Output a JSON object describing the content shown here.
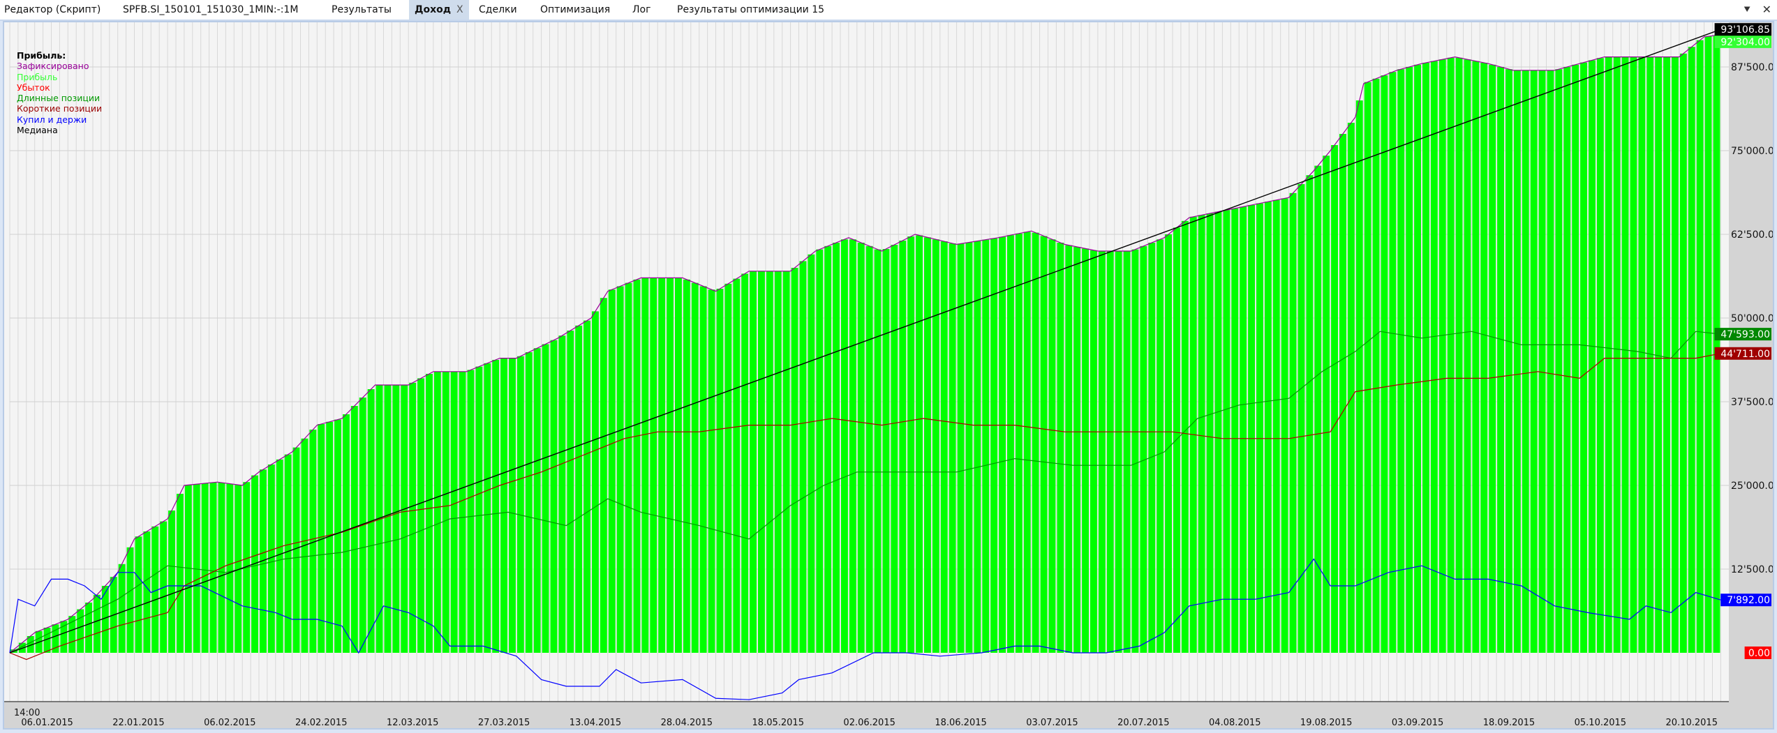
{
  "tabs": [
    {
      "label": "Редактор (Скрипт)"
    },
    {
      "label": "SPFB.SI_150101_151030_1MIN:-:1M"
    },
    {
      "label": "Результаты"
    },
    {
      "label": "Доход",
      "active": true,
      "close": "X"
    },
    {
      "label": "Сделки"
    },
    {
      "label": "Оптимизация"
    },
    {
      "label": "Лог"
    },
    {
      "label": "Результаты оптимизации 15"
    }
  ],
  "window_icons": {
    "menu": "⯆",
    "close": "✕"
  },
  "legend": {
    "title": "Прибыль:",
    "items": [
      {
        "label": "Зафиксировано",
        "color": "#990099"
      },
      {
        "label": "Прибыль",
        "color": "#33ff33"
      },
      {
        "label": "Убыток",
        "color": "#ff0000"
      },
      {
        "label": "Длинные позиции",
        "color": "#009900"
      },
      {
        "label": "Короткие позиции",
        "color": "#990000"
      },
      {
        "label": "Купил и держи",
        "color": "#0000ff"
      },
      {
        "label": "Медиана",
        "color": "#000000"
      }
    ]
  },
  "chart_data": {
    "type": "bar",
    "x_unit": "trading day index",
    "time_label": "14:00",
    "xlim": [
      0,
      206
    ],
    "ylim": [
      -7290,
      97000
    ],
    "x_ticks": [
      {
        "x": 4.5,
        "label": "06.01.2015"
      },
      {
        "x": 15.5,
        "label": "22.01.2015"
      },
      {
        "x": 26.5,
        "label": "06.02.2015"
      },
      {
        "x": 37.5,
        "label": "24.02.2015"
      },
      {
        "x": 48.5,
        "label": "12.03.2015"
      },
      {
        "x": 59.5,
        "label": "27.03.2015"
      },
      {
        "x": 70.5,
        "label": "13.04.2015"
      },
      {
        "x": 81.5,
        "label": "28.04.2015"
      },
      {
        "x": 92.5,
        "label": "18.05.2015"
      },
      {
        "x": 103.5,
        "label": "02.06.2015"
      },
      {
        "x": 114.5,
        "label": "18.06.2015"
      },
      {
        "x": 125.5,
        "label": "03.07.2015"
      },
      {
        "x": 136.5,
        "label": "20.07.2015"
      },
      {
        "x": 147.5,
        "label": "04.08.2015"
      },
      {
        "x": 158.5,
        "label": "19.08.2015"
      },
      {
        "x": 169.5,
        "label": "03.09.2015"
      },
      {
        "x": 180.5,
        "label": "18.09.2015"
      },
      {
        "x": 191.5,
        "label": "05.10.2015"
      },
      {
        "x": 202.5,
        "label": "20.10.2015"
      }
    ],
    "y_ticks": [
      {
        "y": 87500,
        "label": "87'500.00"
      },
      {
        "y": 75000,
        "label": "75'000.00"
      },
      {
        "y": 62500,
        "label": "62'500.00"
      },
      {
        "y": 50000,
        "label": "50'000.00"
      },
      {
        "y": 37500,
        "label": "37'500.00"
      },
      {
        "y": 25000,
        "label": "25'000.00"
      },
      {
        "y": 12500,
        "label": "12'500.00"
      }
    ],
    "value_labels": [
      {
        "y": 92304,
        "label": "92'304.00",
        "bg": "#33ff33",
        "fg": "#ffffff"
      },
      {
        "y": 93106.85,
        "label": "93'106.85",
        "bg": "#000000",
        "fg": "#ffffff"
      },
      {
        "y": 47593,
        "label": "47'593.00",
        "bg": "#008800",
        "fg": "#ffffff"
      },
      {
        "y": 44711,
        "label": "44'711.00",
        "bg": "#a00000",
        "fg": "#ffffff"
      },
      {
        "y": 7892,
        "label": "7'892.00",
        "bg": "#0000ff",
        "fg": "#ffffff"
      },
      {
        "y": 0,
        "label": "0.00",
        "bg": "#ff0000",
        "fg": "#ffffff"
      }
    ],
    "series": [
      {
        "name": "Прибыль",
        "kind": "bars",
        "color": "#00ff00",
        "points": [
          [
            0,
            0
          ],
          [
            3,
            3000
          ],
          [
            7,
            5000
          ],
          [
            10,
            8000
          ],
          [
            13,
            12000
          ],
          [
            15,
            17000
          ],
          [
            19,
            20000
          ],
          [
            21,
            25000
          ],
          [
            25,
            25500
          ],
          [
            28,
            25000
          ],
          [
            30,
            27000
          ],
          [
            34,
            30000
          ],
          [
            37,
            34000
          ],
          [
            40,
            35000
          ],
          [
            44,
            40000
          ],
          [
            48,
            40000
          ],
          [
            51,
            42000
          ],
          [
            55,
            42000
          ],
          [
            59,
            44000
          ],
          [
            61,
            44000
          ],
          [
            66,
            47000
          ],
          [
            70,
            50000
          ],
          [
            72,
            54000
          ],
          [
            76,
            56000
          ],
          [
            81,
            56000
          ],
          [
            85,
            54000
          ],
          [
            89,
            57000
          ],
          [
            94,
            57000
          ],
          [
            97,
            60000
          ],
          [
            101,
            62000
          ],
          [
            105,
            60000
          ],
          [
            109,
            62500
          ],
          [
            114,
            61000
          ],
          [
            119,
            62000
          ],
          [
            123,
            63000
          ],
          [
            127,
            61000
          ],
          [
            131,
            60000
          ],
          [
            135,
            60000
          ],
          [
            139,
            62000
          ],
          [
            142,
            65000
          ],
          [
            146,
            66000
          ],
          [
            150,
            67000
          ],
          [
            154,
            68000
          ],
          [
            157,
            72000
          ],
          [
            159,
            75000
          ],
          [
            162,
            80000
          ],
          [
            163,
            85000
          ],
          [
            167,
            87000
          ],
          [
            170,
            88000
          ],
          [
            174,
            89000
          ],
          [
            178,
            88000
          ],
          [
            181,
            87000
          ],
          [
            186,
            87000
          ],
          [
            192,
            89000
          ],
          [
            197,
            89000
          ],
          [
            201,
            89000
          ],
          [
            204,
            92000
          ],
          [
            206,
            92304
          ]
        ]
      },
      {
        "name": "Зафиксировано",
        "kind": "line",
        "color": "#990099",
        "points": [
          [
            0,
            0
          ],
          [
            3,
            3000
          ],
          [
            7,
            5000
          ],
          [
            10,
            8000
          ],
          [
            13,
            12000
          ],
          [
            15,
            17000
          ],
          [
            19,
            20000
          ],
          [
            21,
            25000
          ],
          [
            25,
            25500
          ],
          [
            28,
            25000
          ],
          [
            30,
            27000
          ],
          [
            34,
            30000
          ],
          [
            37,
            34000
          ],
          [
            40,
            35000
          ],
          [
            44,
            40000
          ],
          [
            48,
            40000
          ],
          [
            51,
            42000
          ],
          [
            55,
            42000
          ],
          [
            59,
            44000
          ],
          [
            61,
            44000
          ],
          [
            66,
            47000
          ],
          [
            70,
            50000
          ],
          [
            72,
            54000
          ],
          [
            76,
            56000
          ],
          [
            81,
            56000
          ],
          [
            85,
            54000
          ],
          [
            89,
            57000
          ],
          [
            94,
            57000
          ],
          [
            97,
            60000
          ],
          [
            101,
            62000
          ],
          [
            105,
            60000
          ],
          [
            109,
            62500
          ],
          [
            114,
            61000
          ],
          [
            119,
            62000
          ],
          [
            123,
            63000
          ],
          [
            127,
            61000
          ],
          [
            131,
            60000
          ],
          [
            135,
            60000
          ],
          [
            139,
            62000
          ],
          [
            142,
            65000
          ],
          [
            146,
            66000
          ],
          [
            150,
            67000
          ],
          [
            154,
            68000
          ],
          [
            157,
            72000
          ],
          [
            159,
            75000
          ],
          [
            162,
            80000
          ],
          [
            163,
            85000
          ],
          [
            167,
            87000
          ],
          [
            170,
            88000
          ],
          [
            174,
            89000
          ],
          [
            178,
            88000
          ],
          [
            181,
            87000
          ],
          [
            186,
            87000
          ],
          [
            192,
            89000
          ],
          [
            197,
            89000
          ],
          [
            201,
            89000
          ],
          [
            204,
            92000
          ],
          [
            206,
            92304
          ]
        ]
      },
      {
        "name": "Длинные позиции",
        "kind": "line",
        "color": "#009900",
        "points": [
          [
            0,
            0
          ],
          [
            13,
            8000
          ],
          [
            19,
            13000
          ],
          [
            26,
            12000
          ],
          [
            33,
            14000
          ],
          [
            40,
            15000
          ],
          [
            47,
            17000
          ],
          [
            53,
            20000
          ],
          [
            60,
            21000
          ],
          [
            67,
            19000
          ],
          [
            72,
            23000
          ],
          [
            76,
            21000
          ],
          [
            83,
            19000
          ],
          [
            89,
            17000
          ],
          [
            94,
            22000
          ],
          [
            98,
            25000
          ],
          [
            102,
            27000
          ],
          [
            108,
            27000
          ],
          [
            114,
            27000
          ],
          [
            121,
            29000
          ],
          [
            128,
            28000
          ],
          [
            135,
            28000
          ],
          [
            139,
            30000
          ],
          [
            143,
            35000
          ],
          [
            148,
            37000
          ],
          [
            154,
            38000
          ],
          [
            158,
            42000
          ],
          [
            162,
            45000
          ],
          [
            165,
            48000
          ],
          [
            170,
            47000
          ],
          [
            176,
            48000
          ],
          [
            182,
            46000
          ],
          [
            189,
            46000
          ],
          [
            196,
            45000
          ],
          [
            200,
            44000
          ],
          [
            203,
            48000
          ],
          [
            206,
            47593
          ]
        ]
      },
      {
        "name": "Короткие позиции",
        "kind": "line",
        "color": "#aa0000",
        "points": [
          [
            0,
            0
          ],
          [
            2,
            -1000
          ],
          [
            6,
            1000
          ],
          [
            13,
            4000
          ],
          [
            19,
            6000
          ],
          [
            21,
            10000
          ],
          [
            26,
            13000
          ],
          [
            33,
            16000
          ],
          [
            40,
            18000
          ],
          [
            47,
            21000
          ],
          [
            53,
            22000
          ],
          [
            59,
            25000
          ],
          [
            64,
            27000
          ],
          [
            70,
            30000
          ],
          [
            74,
            32000
          ],
          [
            78,
            33000
          ],
          [
            83,
            33000
          ],
          [
            89,
            34000
          ],
          [
            94,
            34000
          ],
          [
            99,
            35000
          ],
          [
            105,
            34000
          ],
          [
            110,
            35000
          ],
          [
            116,
            34000
          ],
          [
            121,
            34000
          ],
          [
            127,
            33000
          ],
          [
            135,
            33000
          ],
          [
            140,
            33000
          ],
          [
            146,
            32000
          ],
          [
            154,
            32000
          ],
          [
            159,
            33000
          ],
          [
            162,
            39000
          ],
          [
            167,
            40000
          ],
          [
            173,
            41000
          ],
          [
            178,
            41000
          ],
          [
            184,
            42000
          ],
          [
            189,
            41000
          ],
          [
            192,
            44000
          ],
          [
            197,
            44000
          ],
          [
            203,
            44000
          ],
          [
            206,
            44711
          ]
        ]
      },
      {
        "name": "Купил и держи",
        "kind": "line",
        "color": "#0000ff",
        "points": [
          [
            0,
            0
          ],
          [
            1,
            8000
          ],
          [
            3,
            7000
          ],
          [
            5,
            11000
          ],
          [
            7,
            11000
          ],
          [
            9,
            10000
          ],
          [
            11,
            8000
          ],
          [
            13,
            12000
          ],
          [
            15,
            12000
          ],
          [
            17,
            9000
          ],
          [
            19,
            10000
          ],
          [
            23,
            10000
          ],
          [
            28,
            7000
          ],
          [
            32,
            6000
          ],
          [
            34,
            5000
          ],
          [
            37,
            5000
          ],
          [
            40,
            4000
          ],
          [
            42,
            0
          ],
          [
            45,
            7000
          ],
          [
            48,
            6000
          ],
          [
            51,
            4000
          ],
          [
            53,
            1000
          ],
          [
            57,
            1000
          ],
          [
            61,
            -500
          ],
          [
            64,
            -4000
          ],
          [
            67,
            -5000
          ],
          [
            71,
            -5000
          ],
          [
            73,
            -2500
          ],
          [
            76,
            -4500
          ],
          [
            81,
            -4000
          ],
          [
            85,
            -6800
          ],
          [
            89,
            -7000
          ],
          [
            93,
            -6000
          ],
          [
            95,
            -4000
          ],
          [
            99,
            -3000
          ],
          [
            104,
            0
          ],
          [
            108,
            0
          ],
          [
            112,
            -500
          ],
          [
            117,
            0
          ],
          [
            121,
            1000
          ],
          [
            124,
            1000
          ],
          [
            128,
            0
          ],
          [
            132,
            0
          ],
          [
            136,
            1000
          ],
          [
            139,
            3000
          ],
          [
            142,
            7000
          ],
          [
            146,
            8000
          ],
          [
            150,
            8000
          ],
          [
            154,
            9000
          ],
          [
            157,
            14000
          ],
          [
            159,
            10000
          ],
          [
            162,
            10000
          ],
          [
            166,
            12000
          ],
          [
            170,
            13000
          ],
          [
            174,
            11000
          ],
          [
            178,
            11000
          ],
          [
            182,
            10000
          ],
          [
            186,
            7000
          ],
          [
            190,
            6000
          ],
          [
            195,
            5000
          ],
          [
            197,
            7000
          ],
          [
            200,
            6000
          ],
          [
            203,
            9000
          ],
          [
            206,
            7892
          ]
        ]
      },
      {
        "name": "Медиана",
        "kind": "line",
        "color": "#000000",
        "points": [
          [
            0,
            0
          ],
          [
            206,
            93106.85
          ]
        ]
      }
    ]
  }
}
